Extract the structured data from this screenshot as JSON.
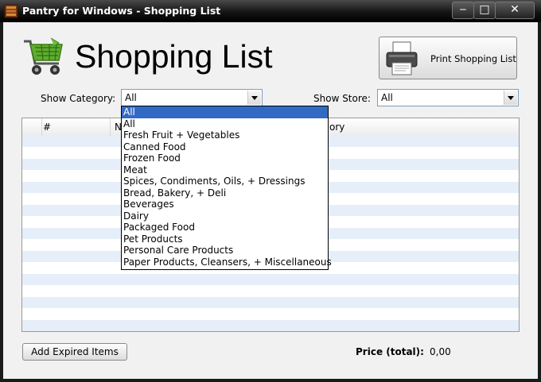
{
  "window": {
    "title": "Pantry for Windows - Shopping List",
    "minimize_glyph": "‒",
    "maximize_glyph": "□",
    "close_glyph": "✕"
  },
  "header": {
    "title": "Shopping List",
    "print_button_label": "Print Shopping List"
  },
  "filters": {
    "category_label": "Show Category:",
    "category_value": "All",
    "store_label": "Show Store:",
    "store_value": "All"
  },
  "category_dropdown": {
    "options": [
      "All",
      "All",
      "Fresh Fruit + Vegetables",
      "Canned Food",
      "Frozen Food",
      "Meat",
      "Spices, Condiments, Oils, + Dressings",
      "Bread, Bakery, + Deli",
      "Beverages",
      "Dairy",
      "Packaged Food",
      "Pet Products",
      "Personal Care Products",
      "Paper Products, Cleansers, + Miscellaneous"
    ],
    "selected_index": 0
  },
  "table": {
    "columns": [
      "#",
      "N",
      "ory"
    ]
  },
  "footer": {
    "add_expired_label": "Add Expired Items",
    "price_label": "Price (total):",
    "price_value": "0,00"
  },
  "colors": {
    "selection": "#316ac5",
    "row_alt": "#e6eef9",
    "title_bar": "#141414"
  }
}
